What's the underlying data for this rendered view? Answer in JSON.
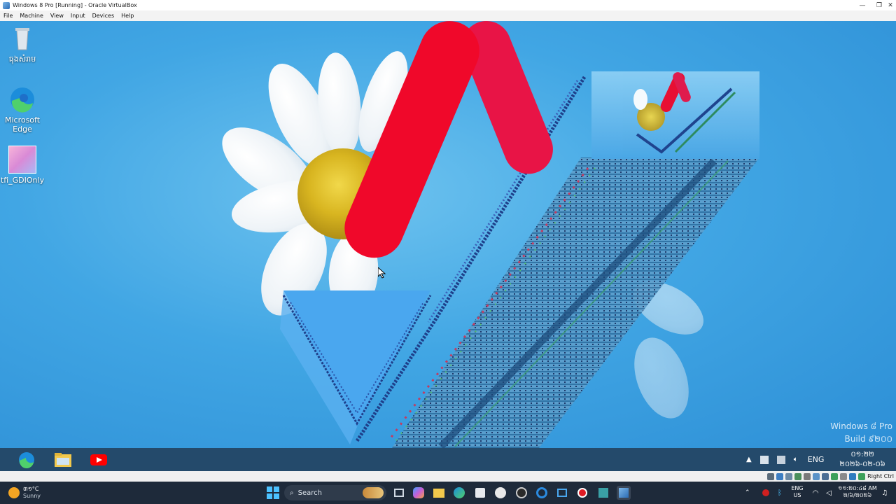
{
  "window": {
    "title": "Windows 8 Pro [Running] - Oracle VirtualBox",
    "menu": [
      "File",
      "Machine",
      "View",
      "Input",
      "Devices",
      "Help"
    ],
    "controls": [
      "minimize-icon",
      "restore-icon",
      "close-icon"
    ]
  },
  "desktop": {
    "icons": [
      {
        "label": "ធុងសំរាម",
        "icon": "recycle-bin-icon"
      },
      {
        "label": "Microsoft Edge",
        "icon": "edge-icon"
      },
      {
        "label": "tfi_GDIOnly",
        "icon": "anime-app-icon"
      }
    ],
    "watermark": {
      "line1": "Windows ៨ Pro",
      "line2": "Build ៩២០០"
    }
  },
  "guest_taskbar": {
    "pinned": [
      "edge-icon",
      "file-explorer-icon",
      "youtube-icon"
    ],
    "tray": {
      "language": "ENG",
      "time": "០១:២២",
      "date": "២០២៦-០២-០៦"
    }
  },
  "vb_status": {
    "host_key": "Right Ctrl"
  },
  "host_taskbar": {
    "weather": {
      "temp": "៣១°C",
      "condition": "Sunny"
    },
    "search_placeholder": "Search",
    "lang": {
      "line1": "ENG",
      "line2": "US"
    },
    "clock": {
      "time": "១១:២០:៤៨ AM",
      "date": "២/៦/២០២៦"
    }
  },
  "colors": {
    "desktop_blue": "#41a6e4",
    "red_logo": "#f0082a",
    "host_taskbar": "#1e2a3a"
  }
}
